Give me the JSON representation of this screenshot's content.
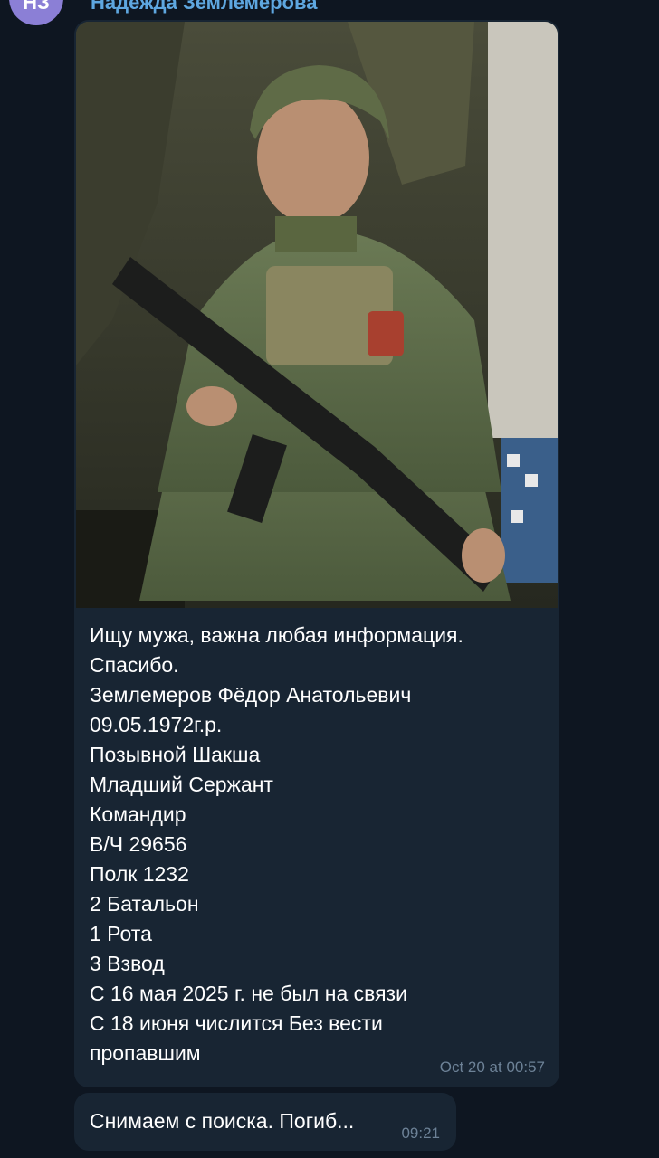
{
  "chat": {
    "avatar_initials": "НЗ",
    "sender_name": "Надежда Землемерова"
  },
  "messages": [
    {
      "photo_icon": "soldier-photo",
      "lines": [
        "Ищу мужа, важна любая информация.",
        "Спасибо.",
        "Землемеров Фёдор Анатольевич",
        "09.05.1972г.р.",
        "Позывной Шакша",
        "Младший Сержант",
        "Командир",
        "В/Ч 29656",
        "Полк 1232",
        "2 Батальон",
        "1 Рота",
        "3 Взвод",
        "С 16 мая 2025 г. не был на связи",
        "С 18 июня числится Без вести",
        "пропавшим"
      ],
      "time": "Oct 20 at 00:57"
    },
    {
      "text": "Снимаем с поиска. Погиб...",
      "time": "09:21"
    }
  ],
  "colors": {
    "background": "#0e1621",
    "bubble": "#182533",
    "sender_name": "#5ea7e0",
    "avatar": "#8b7fd6",
    "meta": "#6d8297"
  }
}
